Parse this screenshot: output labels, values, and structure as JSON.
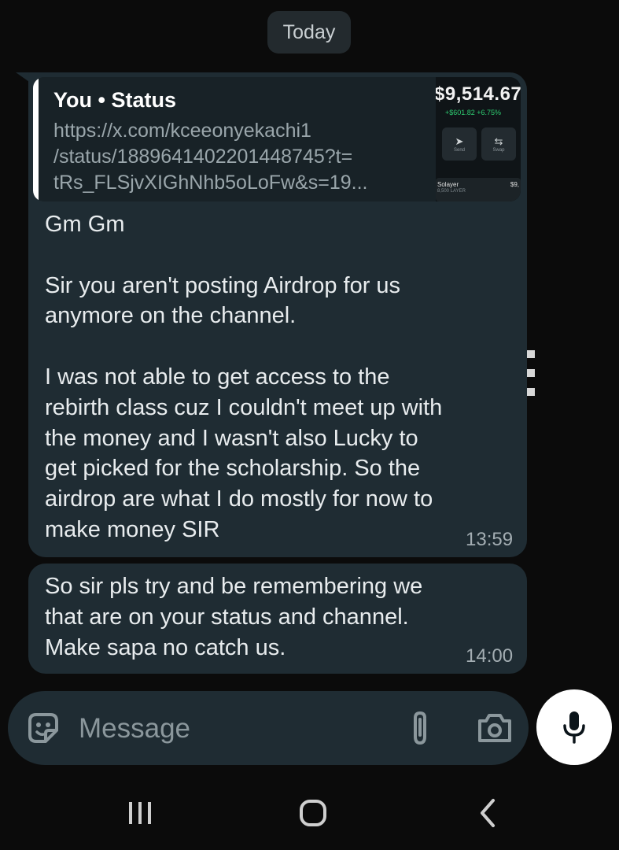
{
  "date_divider": "Today",
  "message1": {
    "quote": {
      "author": "You • Status",
      "link": "https://x.com/kceeonyekachi1\n/status/1889641402201448745?t=\ntRs_FLSjvXIGhNhb5oLoFw&s=19...",
      "thumbnail": {
        "price": "$9,514.67",
        "change": "+$601.82  +6.75%",
        "send_label": "Send",
        "swap_label": "Swap",
        "token_name": "Solayer",
        "token_sub": "8,500 LAYER",
        "token_value": "$9,"
      }
    },
    "text": "Gm Gm\n\nSir you aren't posting Airdrop for us\nanymore on the channel.\n\nI was not able to get access to the\nrebirth class cuz I couldn't meet up with\nthe money and I wasn't also Lucky to\nget picked for the scholarship. So the\nairdrop are what I do mostly for now to\nmake money SIR",
    "time": "13:59"
  },
  "message2": {
    "text": "So sir pls try and be remembering we\nthat are on your status and channel.\nMake sapa no catch us.",
    "time": "14:00"
  },
  "composer": {
    "placeholder": "Message"
  },
  "icons": {
    "emoji": "sticker-icon",
    "attach": "paperclip-icon",
    "camera": "camera-icon",
    "mic": "microphone-icon",
    "nav_recents": "recents-icon",
    "nav_home": "home-icon",
    "nav_back": "back-icon"
  },
  "colors": {
    "background": "#0b0b0b",
    "bubble": "#1f2c33",
    "quote_bg": "#182227",
    "time": "#a3adb2",
    "positive_change": "#2ecc71"
  }
}
